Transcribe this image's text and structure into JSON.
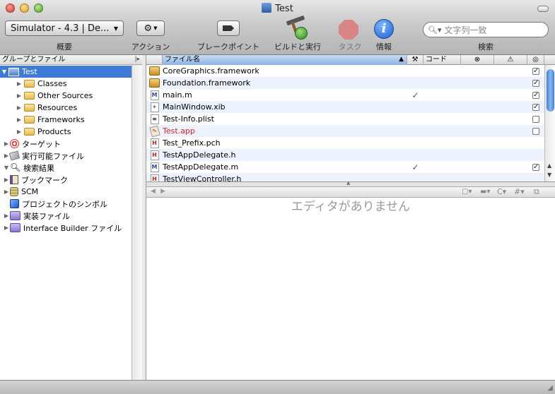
{
  "window": {
    "title": "Test"
  },
  "toolbar": {
    "scheme_popup": "Simulator - 4.3 | De...",
    "overview_label": "概要",
    "action_label": "アクション",
    "breakpoints_label": "ブレークポイント",
    "build_run_label": "ビルドと実行",
    "tasks_label": "タスク",
    "info_label": "情報",
    "search_label": "検索",
    "search_placeholder": "文字列一致"
  },
  "sidebar": {
    "header": "グループとファイル",
    "items": [
      {
        "label": "Test",
        "level": 0,
        "expanded": true,
        "icon": "project-icon"
      },
      {
        "label": "Classes",
        "level": 1,
        "icon": "folder-icon"
      },
      {
        "label": "Other Sources",
        "level": 1,
        "icon": "folder-icon"
      },
      {
        "label": "Resources",
        "level": 1,
        "icon": "folder-icon"
      },
      {
        "label": "Frameworks",
        "level": 1,
        "icon": "folder-icon"
      },
      {
        "label": "Products",
        "level": 1,
        "icon": "folder-icon"
      },
      {
        "label": "ターゲット",
        "level": 0,
        "icon": "target-icon"
      },
      {
        "label": "実行可能ファイル",
        "level": 0,
        "icon": "executable-icon"
      },
      {
        "label": "検索結果",
        "level": 0,
        "expanded": true,
        "icon": "magnifier-icon"
      },
      {
        "label": "ブックマーク",
        "level": 0,
        "icon": "bookmark-icon"
      },
      {
        "label": "SCM",
        "level": 0,
        "icon": "scm-icon"
      },
      {
        "label": "プロジェクトのシンボル",
        "level": 0,
        "icon": "symbols-icon"
      },
      {
        "label": "実装ファイル",
        "level": 0,
        "icon": "smart-group-icon"
      },
      {
        "label": "Interface Builder ファイル",
        "level": 0,
        "icon": "smart-group-icon"
      }
    ]
  },
  "file_list": {
    "columns": {
      "filename": "ファイル名",
      "code": "コード"
    },
    "rows": [
      {
        "name": "CoreGraphics.framework",
        "type": "framework",
        "built": false,
        "checked": true
      },
      {
        "name": "Foundation.framework",
        "type": "framework",
        "built": false,
        "checked": true
      },
      {
        "name": "main.m",
        "type": "M",
        "built": true,
        "checked": true
      },
      {
        "name": "MainWindow.xib",
        "type": "xib",
        "built": false,
        "checked": true
      },
      {
        "name": "Test-Info.plist",
        "type": "plist",
        "built": false,
        "checked": false
      },
      {
        "name": "Test.app",
        "type": "app",
        "built": false,
        "checked": false,
        "missing": true
      },
      {
        "name": "Test_Prefix.pch",
        "type": "H",
        "built": false,
        "checked": null
      },
      {
        "name": "TestAppDelegate.h",
        "type": "H",
        "built": false,
        "checked": null
      },
      {
        "name": "TestAppDelegate.m",
        "type": "M",
        "built": true,
        "checked": true
      },
      {
        "name": "TestViewController.h",
        "type": "H",
        "built": false,
        "checked": null
      }
    ]
  },
  "editor": {
    "empty_text": "エディタがありません"
  },
  "colors": {
    "selection": "#3d7bd6",
    "missing_file": "#e02020"
  }
}
